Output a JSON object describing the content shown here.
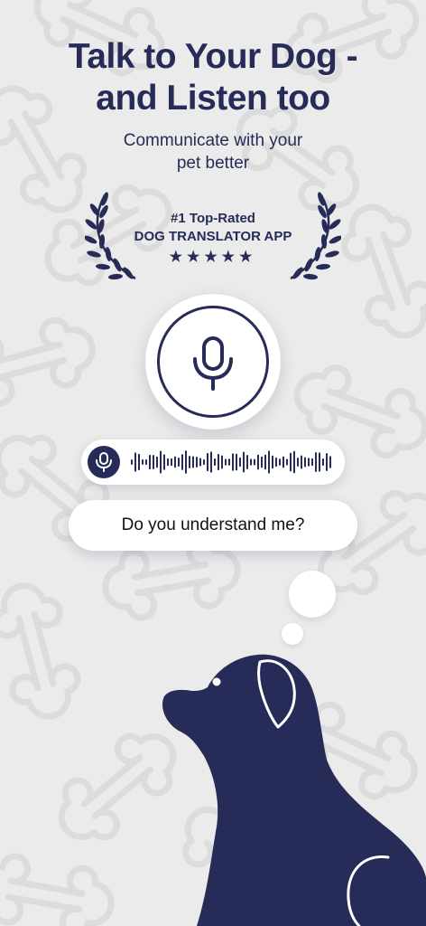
{
  "header": {
    "title_line1": "Talk to Your Dog -",
    "title_line2": "and Listen too",
    "subtitle_line1": "Communicate with your",
    "subtitle_line2": "pet better"
  },
  "badge": {
    "line1": "#1 Top-Rated",
    "line2": "DOG TRANSLATOR APP",
    "stars": "★★★★★",
    "rating": 5
  },
  "icons": {
    "mic": "microphone-icon",
    "laurel": "laurel-wreath-icon",
    "dog": "dog-silhouette",
    "bubble": "thought-bubble"
  },
  "speech": {
    "question": "Do you understand me?"
  },
  "colors": {
    "primary": "#262b57",
    "background": "#ebebeb",
    "bone_pattern": "#dedede",
    "surface": "#ffffff"
  }
}
